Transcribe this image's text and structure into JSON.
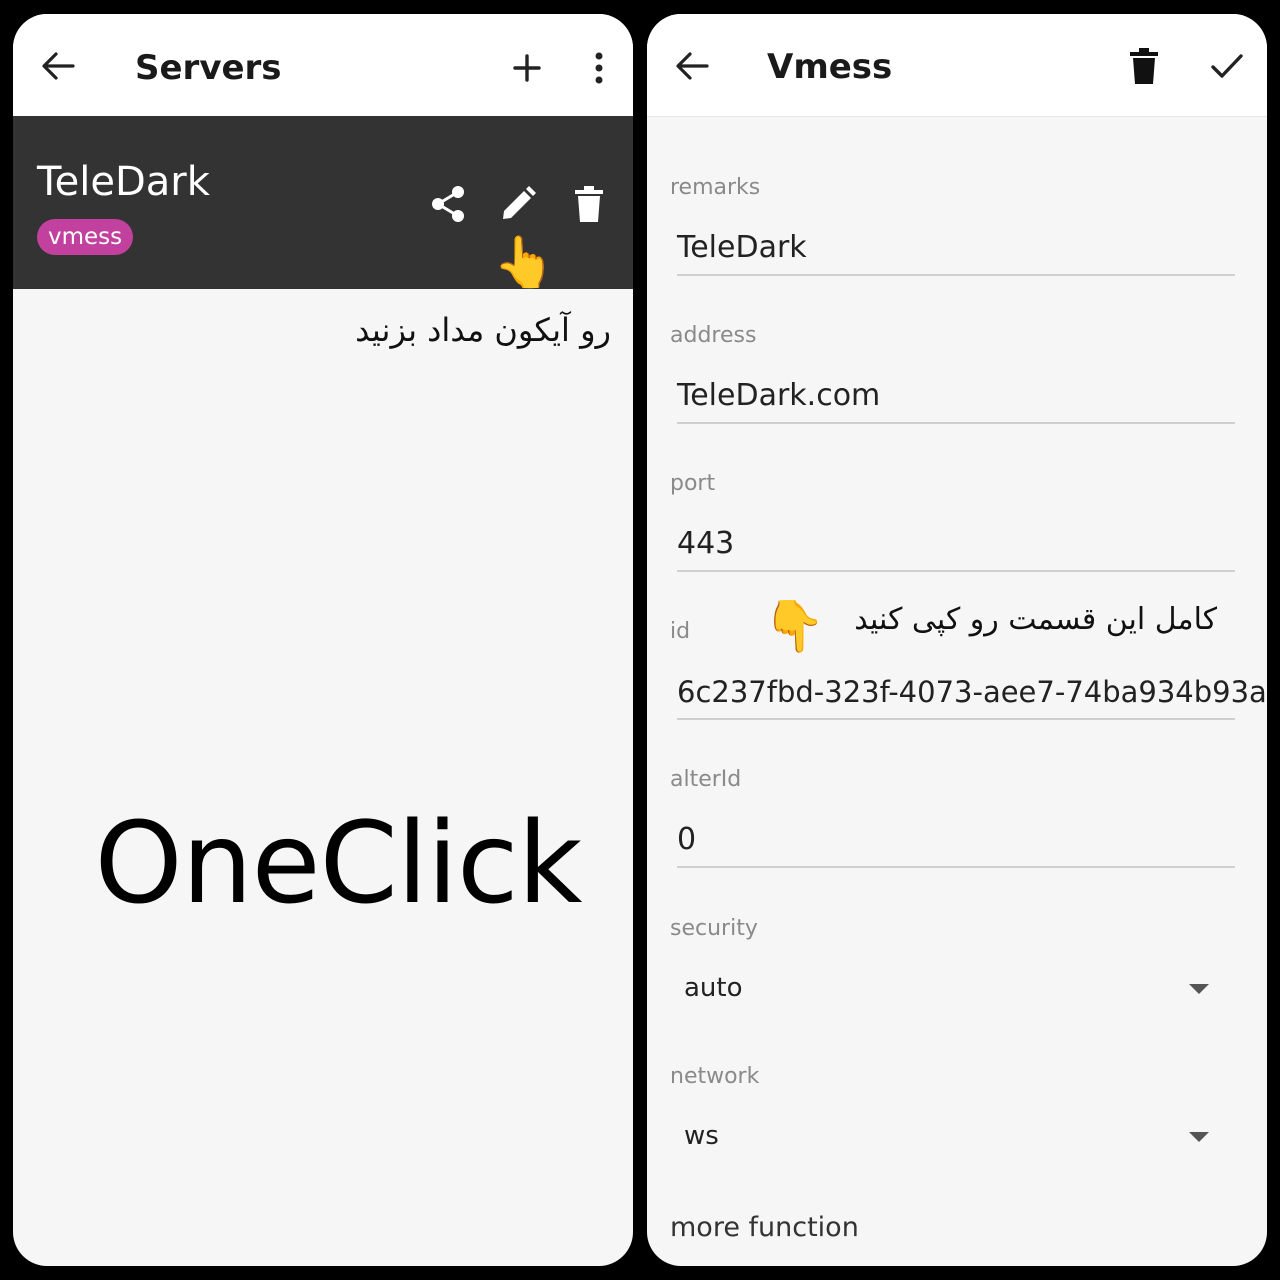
{
  "left": {
    "toolbar": {
      "back_icon": "arrow-left-icon",
      "title": "Servers",
      "add_icon": "plus-icon",
      "menu_icon": "more-vert-icon"
    },
    "server": {
      "name": "TeleDark",
      "type": "vmess",
      "badge_color": "#c2419e",
      "share_icon": "share-icon",
      "edit_icon": "pencil-icon",
      "delete_icon": "trash-icon"
    },
    "pointer_emoji": "👆",
    "instruction": "رو آیکون مداد بزنید",
    "watermark": "OneClick"
  },
  "right": {
    "toolbar": {
      "back_icon": "arrow-left-icon",
      "title": "Vmess",
      "delete_icon": "trash-icon",
      "save_icon": "check-icon"
    },
    "fields": {
      "remarks": {
        "label": "remarks",
        "value": "TeleDark"
      },
      "address": {
        "label": "address",
        "value": "TeleDark.com"
      },
      "port": {
        "label": "port",
        "value": "443"
      },
      "id": {
        "label": "id",
        "value": "6c237fbd-323f-4073-aee7-74ba934b93a"
      },
      "alterId": {
        "label": "alterId",
        "value": "0"
      },
      "security": {
        "label": "security",
        "value": "auto"
      },
      "network": {
        "label": "network",
        "value": "ws"
      }
    },
    "pointer_emoji": "👇",
    "instruction": "کامل این قسمت رو کپی کنید",
    "more_function": "more function"
  },
  "colors": {
    "server_card_bg": "#333333",
    "toolbar_bg": "#ffffff",
    "panel_bg": "#f6f6f6"
  }
}
